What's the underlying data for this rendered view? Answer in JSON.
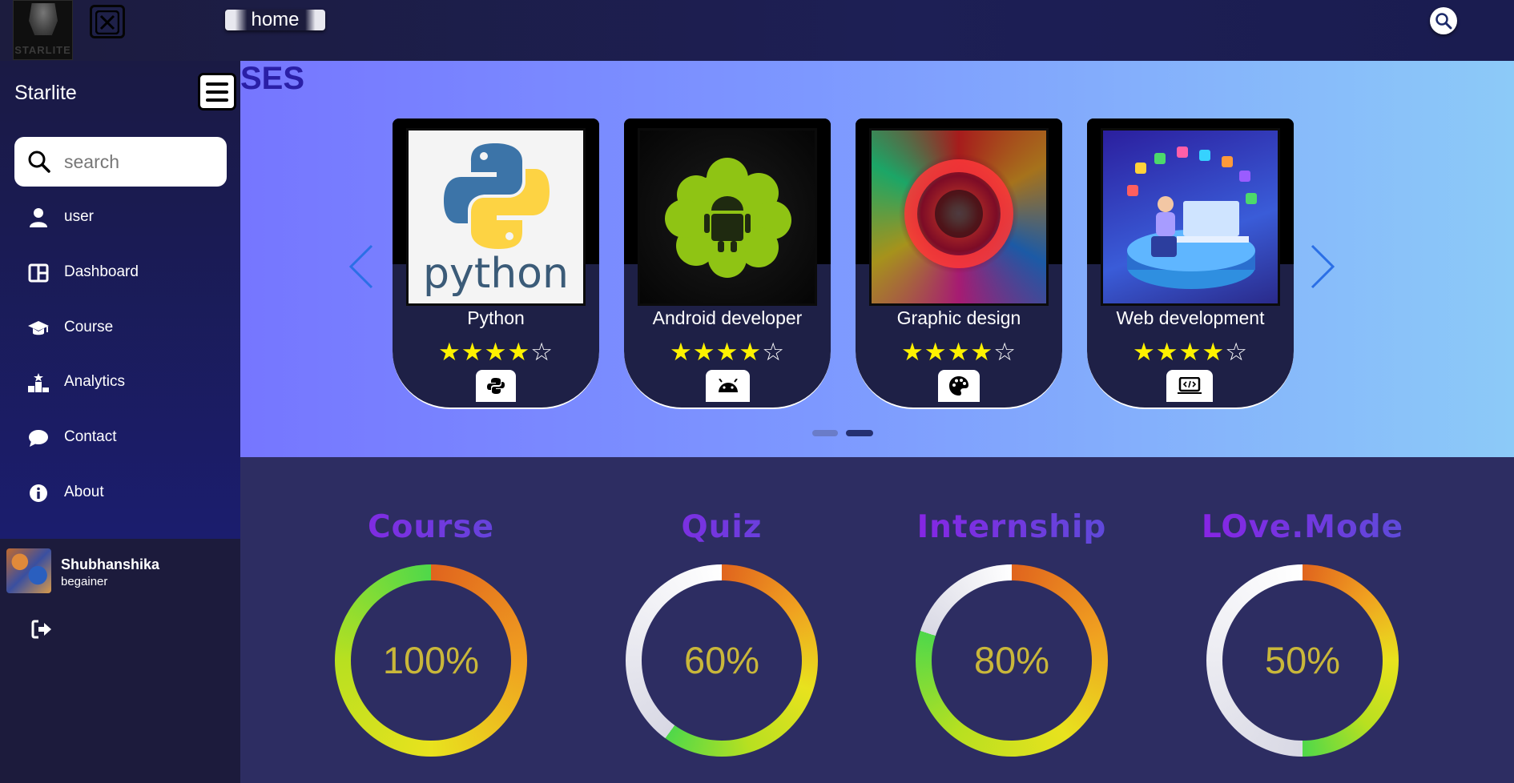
{
  "topbar": {
    "logo_text": "STARLITE",
    "home_label": "home"
  },
  "sidebar": {
    "title": "Starlite",
    "search_placeholder": "search",
    "items": [
      {
        "label": "user",
        "icon": "user-icon"
      },
      {
        "label": "Dashboard",
        "icon": "dashboard-icon"
      },
      {
        "label": "Course",
        "icon": "graduation-cap-icon"
      },
      {
        "label": "Analytics",
        "icon": "analytics-icon"
      },
      {
        "label": "Contact",
        "icon": "chat-icon"
      },
      {
        "label": "About",
        "icon": "info-icon"
      }
    ],
    "user": {
      "name": "Shubhanshika",
      "level": "begainer"
    }
  },
  "hero": {
    "title": "SES",
    "courses": [
      {
        "name": "Python",
        "rating": 4,
        "max_rating": 5,
        "badge_icon": "python-icon",
        "image_text": "python"
      },
      {
        "name": "Android developer",
        "rating": 4,
        "max_rating": 5,
        "badge_icon": "android-icon"
      },
      {
        "name": "Graphic design",
        "rating": 4,
        "max_rating": 5,
        "badge_icon": "palette-icon"
      },
      {
        "name": "Web development",
        "rating": 4,
        "max_rating": 5,
        "badge_icon": "laptop-code-icon"
      }
    ],
    "carousel": {
      "pages": 2,
      "active_page": 2
    }
  },
  "stats": [
    {
      "label": "Course",
      "percent_text": "100%",
      "value": 100
    },
    {
      "label": "Quiz",
      "percent_text": "60%",
      "value": 60
    },
    {
      "label": "Internship",
      "percent_text": "80%",
      "value": 80
    },
    {
      "label": "LOve.Mode",
      "percent_text": "50%",
      "value": 50
    }
  ],
  "colors": {
    "accent_purple": "#7a2bd6",
    "percent_gold": "#c9b73a",
    "star_yellow": "#fff200",
    "panel_dark": "#2d2d62"
  }
}
